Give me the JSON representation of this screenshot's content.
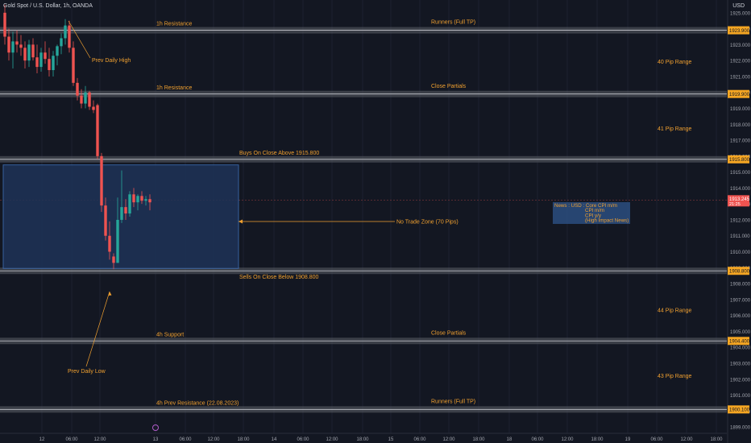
{
  "header": {
    "symbol": "Gold Spot / U.S. Dollar, 1h, OANDA",
    "currency": "USD"
  },
  "colors": {
    "background": "#131722",
    "up": "#26a69a",
    "down": "#ef5350",
    "annotation": "#f0a030",
    "zone_fill": "#1e3357",
    "zone_border": "#3d6db3",
    "band": "#5d6068",
    "axis_text": "#a3a6af",
    "price_tag": "#f5a623",
    "last_tag": "#ef5350",
    "grid": "#1c2030"
  },
  "chart_data": {
    "type": "candlestick",
    "y_range": [
      1898.6,
      1925.8
    ],
    "y_ticks": [
      "1925.000",
      "1924.000",
      "1923.000",
      "1922.000",
      "1921.000",
      "1920.000",
      "1919.000",
      "1918.000",
      "1917.000",
      "1916.000",
      "1915.000",
      "1914.000",
      "1913.000",
      "1912.000",
      "1911.000",
      "1910.000",
      "1909.000",
      "1908.000",
      "1907.000",
      "1906.000",
      "1905.000",
      "1904.000",
      "1903.000",
      "1902.000",
      "1901.000",
      "1900.000",
      "1899.000"
    ],
    "x_ticks": [
      "12",
      "06:00",
      "12:00",
      "13",
      "06:00",
      "12:00",
      "18:00",
      "14",
      "06:00",
      "12:00",
      "18:00",
      "15",
      "06:00",
      "12:00",
      "18:00",
      "18",
      "06:00",
      "12:00",
      "18:00",
      "19",
      "06:00",
      "12:00",
      "18:00"
    ],
    "price_tags": [
      {
        "label": "1923.900",
        "price": 1923.9
      },
      {
        "label": "1919.900",
        "price": 1919.9
      },
      {
        "label": "1915.800",
        "price": 1915.8
      },
      {
        "label": "1908.800",
        "price": 1908.8
      },
      {
        "label": "1904.400",
        "price": 1904.4
      },
      {
        "label": "1900.100",
        "price": 1900.1
      }
    ],
    "last_price": {
      "label": "1913.245",
      "sub": "21:25",
      "price": 1913.245
    },
    "bands": [
      {
        "price": 1923.9
      },
      {
        "price": 1919.9
      },
      {
        "price": 1915.8
      },
      {
        "price": 1908.8
      },
      {
        "price": 1904.4
      },
      {
        "price": 1900.1
      }
    ],
    "candles": [
      [
        1925.0,
        1925.5,
        1923.0,
        1923.5
      ],
      [
        1923.5,
        1924.0,
        1922.0,
        1922.5
      ],
      [
        1922.5,
        1923.8,
        1921.5,
        1923.2
      ],
      [
        1923.2,
        1923.9,
        1922.5,
        1923.0
      ],
      [
        1923.0,
        1923.6,
        1922.3,
        1922.8
      ],
      [
        1922.8,
        1923.2,
        1921.5,
        1922.0
      ],
      [
        1922.0,
        1923.3,
        1921.6,
        1923.0
      ],
      [
        1923.0,
        1923.4,
        1922.0,
        1922.2
      ],
      [
        1922.2,
        1923.0,
        1921.2,
        1921.6
      ],
      [
        1921.6,
        1922.8,
        1921.3,
        1922.5
      ],
      [
        1922.5,
        1923.2,
        1921.8,
        1922.1
      ],
      [
        1922.1,
        1922.8,
        1921.0,
        1921.4
      ],
      [
        1921.4,
        1922.6,
        1921.0,
        1922.3
      ],
      [
        1922.3,
        1923.0,
        1921.7,
        1922.9
      ],
      [
        1922.9,
        1923.7,
        1922.4,
        1923.4
      ],
      [
        1923.4,
        1924.6,
        1923.0,
        1924.2
      ],
      [
        1924.2,
        1924.5,
        1922.5,
        1922.8
      ],
      [
        1922.8,
        1923.2,
        1920.4,
        1920.6
      ],
      [
        1920.6,
        1920.9,
        1919.5,
        1919.8
      ],
      [
        1919.8,
        1920.2,
        1919.0,
        1919.3
      ],
      [
        1919.3,
        1920.4,
        1919.0,
        1920.0
      ],
      [
        1920.0,
        1920.1,
        1918.9,
        1919.1
      ],
      [
        1919.1,
        1919.5,
        1918.7,
        1918.9
      ],
      [
        1919.2,
        1919.3,
        1915.8,
        1916.0
      ],
      [
        1916.0,
        1916.2,
        1912.5,
        1912.9
      ],
      [
        1912.9,
        1913.4,
        1910.7,
        1911.0
      ],
      [
        1911.0,
        1911.9,
        1909.5,
        1910.0
      ],
      [
        1909.7,
        1909.9,
        1908.9,
        1909.3
      ],
      [
        1909.3,
        1913.4,
        1909.3,
        1912.0
      ],
      [
        1912.0,
        1915.1,
        1911.8,
        1912.8
      ],
      [
        1912.8,
        1913.3,
        1912.0,
        1912.4
      ],
      [
        1912.4,
        1913.8,
        1912.2,
        1913.6
      ],
      [
        1913.6,
        1914.0,
        1912.8,
        1913.1
      ],
      [
        1913.1,
        1913.6,
        1912.6,
        1913.5
      ],
      [
        1913.5,
        1913.8,
        1913.0,
        1913.2
      ],
      [
        1913.2,
        1913.5,
        1912.9,
        1913.3
      ],
      [
        1913.3,
        1913.6,
        1912.6,
        1913.1
      ]
    ],
    "zone": {
      "label": "No Trade Zone (70 Pips)",
      "top": 1915.45,
      "bottom": 1908.95
    },
    "annotations": [
      {
        "text": "1h Resistance",
        "price": 1924.3
      },
      {
        "text": "Runners (Full TP)",
        "price": 1924.4
      },
      {
        "text": "Prev Daily High",
        "price": 1922.0
      },
      {
        "text": "40 Pip Range",
        "price": 1921.9
      },
      {
        "text": "1h Resistance",
        "price": 1920.3
      },
      {
        "text": "Close Partials",
        "price": 1920.4
      },
      {
        "text": "41 Pip Range",
        "price": 1917.7
      },
      {
        "text": "Buys On Close Above 1915.800",
        "price": 1916.2
      },
      {
        "text": "Sells On Close Below 1908.800",
        "price": 1908.4
      },
      {
        "text": "44 Pip Range",
        "price": 1906.3
      },
      {
        "text": "4h Support",
        "price": 1904.8
      },
      {
        "text": "Close Partials",
        "price": 1904.9
      },
      {
        "text": "Prev Daily Low",
        "price": 1902.5
      },
      {
        "text": "43 Pip Range",
        "price": 1902.2
      },
      {
        "text": "4h Prev Resistance (22.08.2023)",
        "price": 1900.5
      },
      {
        "text": "Runners (Full TP)",
        "price": 1900.6
      }
    ],
    "news_box": {
      "lines": [
        "News : USD : Core CPI m/m",
        "CPI m/m",
        "CPI y/y",
        "(High Impact News)"
      ]
    }
  }
}
